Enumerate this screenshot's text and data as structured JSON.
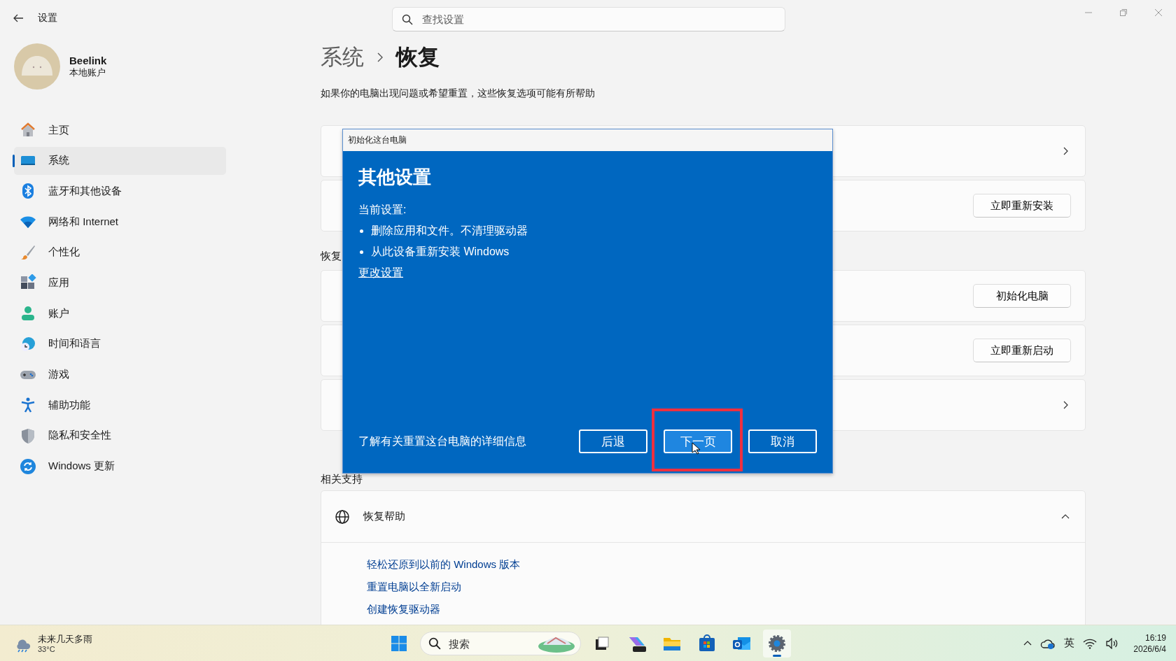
{
  "window": {
    "title": "设置"
  },
  "search": {
    "placeholder": "查找设置"
  },
  "account": {
    "name": "Beelink",
    "type": "本地账户"
  },
  "sidebar": {
    "items": [
      {
        "label": "主页",
        "selected": false
      },
      {
        "label": "系统",
        "selected": true
      },
      {
        "label": "蓝牙和其他设备",
        "selected": false
      },
      {
        "label": "网络和 Internet",
        "selected": false
      },
      {
        "label": "个性化",
        "selected": false
      },
      {
        "label": "应用",
        "selected": false
      },
      {
        "label": "账户",
        "selected": false
      },
      {
        "label": "时间和语言",
        "selected": false
      },
      {
        "label": "游戏",
        "selected": false
      },
      {
        "label": "辅助功能",
        "selected": false
      },
      {
        "label": "隐私和安全性",
        "selected": false
      },
      {
        "label": "Windows 更新",
        "selected": false
      }
    ]
  },
  "page": {
    "breadcrumb": [
      "系统",
      "恢复"
    ],
    "description": "如果你的电脑出现问题或希望重置，这些恢复选项可能有所帮助",
    "groups": [
      {
        "cards": [
          {
            "kind": "chevron"
          },
          {
            "kind": "button",
            "button": "立即重新安装"
          }
        ]
      },
      {
        "label": "恢复",
        "cards": [
          {
            "kind": "button",
            "button": "初始化电脑"
          },
          {
            "kind": "button",
            "button": "立即重新启动"
          },
          {
            "kind": "chevron"
          }
        ]
      }
    ],
    "support_label": "相关支持",
    "help": {
      "title": "恢复帮助",
      "expanded": true,
      "links": [
        "轻松还原到以前的 Windows 版本",
        "重置电脑以全新启动",
        "创建恢复驱动器"
      ]
    }
  },
  "dialog": {
    "title": "初始化这台电脑",
    "heading": "其他设置",
    "current_label": "当前设置:",
    "bullets": [
      "删除应用和文件。不清理驱动器",
      "从此设备重新安装 Windows"
    ],
    "change_link": "更改设置",
    "info_link": "了解有关重置这台电脑的详细信息",
    "buttons": [
      {
        "label": "后退",
        "focused": false,
        "highlighted": false
      },
      {
        "label": "下一页",
        "focused": true,
        "highlighted": true
      },
      {
        "label": "取消",
        "focused": false,
        "highlighted": false
      }
    ]
  },
  "taskbar": {
    "weather": {
      "text": "未来几天多雨",
      "temp": "33°C"
    },
    "search": {
      "placeholder": "搜索"
    },
    "apps": [
      {
        "active": false
      },
      {
        "active": false
      },
      {
        "active": false
      },
      {
        "active": false
      },
      {
        "active": false
      },
      {
        "active": true
      }
    ],
    "ime": "英",
    "time": "16:19",
    "date": "2026/6/4"
  }
}
